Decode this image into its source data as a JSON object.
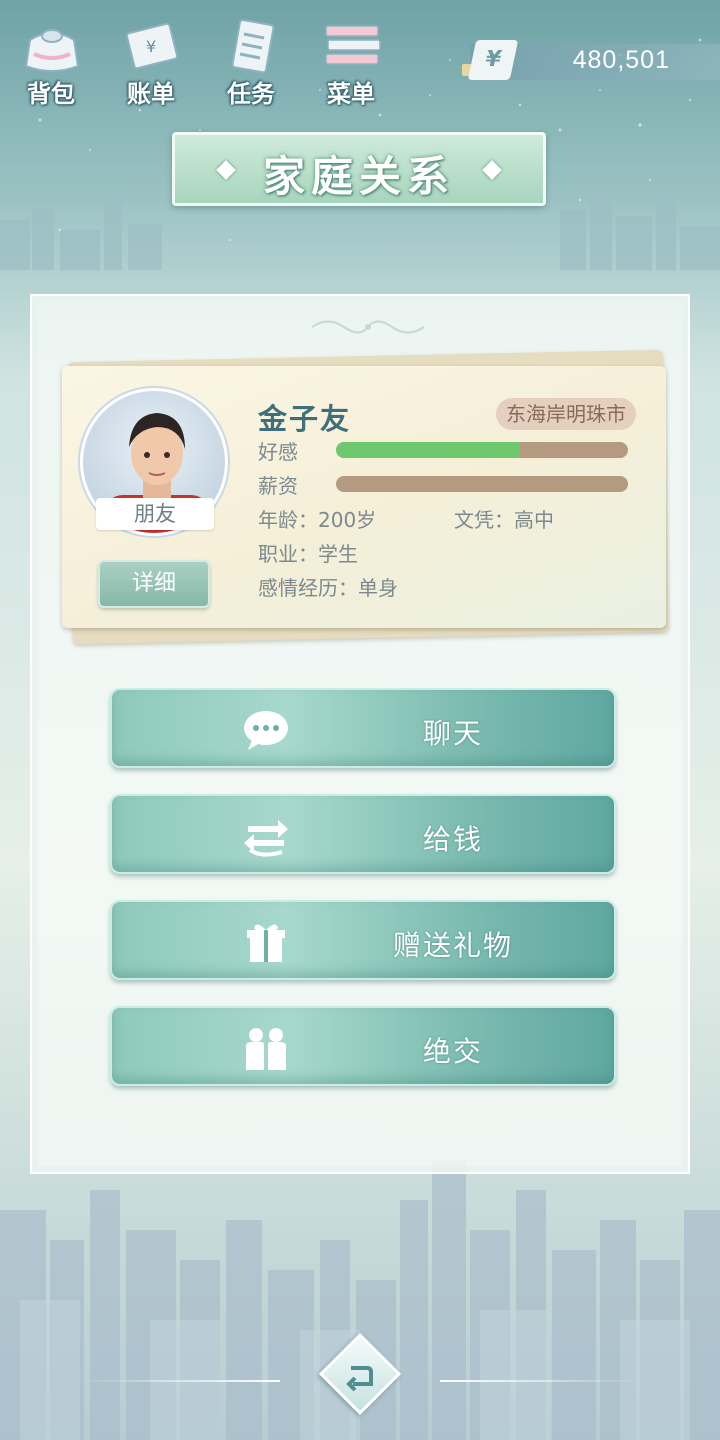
{
  "topbar": {
    "items": [
      {
        "label": "背包",
        "icon": "bag-icon"
      },
      {
        "label": "账单",
        "icon": "bill-icon"
      },
      {
        "label": "任务",
        "icon": "task-icon"
      },
      {
        "label": "菜单",
        "icon": "menu-icon"
      }
    ],
    "currency_symbol": "¥",
    "money": "480,501"
  },
  "title": "家庭关系",
  "profile": {
    "name": "金子友",
    "city": "东海岸明珠市",
    "relation_tag": "朋友",
    "detail_label": "详细",
    "affection_label": "好感",
    "affection_fraction": 0.63,
    "salary_label": "薪资",
    "salary_fraction": 0.0,
    "age": "年龄：200岁",
    "education": "文凭：高中",
    "job": "职业：学生",
    "relationship": "感情经历：单身"
  },
  "actions": [
    {
      "label": "聊天",
      "icon": "chat-icon"
    },
    {
      "label": "给钱",
      "icon": "give-money-icon"
    },
    {
      "label": "赠送礼物",
      "icon": "gift-icon"
    },
    {
      "label": "绝交",
      "icon": "break-friendship-icon"
    }
  ],
  "colors": {
    "accent_teal": "#7dbcb1",
    "affection_green": "#6ec96e",
    "bar_track": "#b39a80",
    "name_color": "#3f6f7a"
  }
}
